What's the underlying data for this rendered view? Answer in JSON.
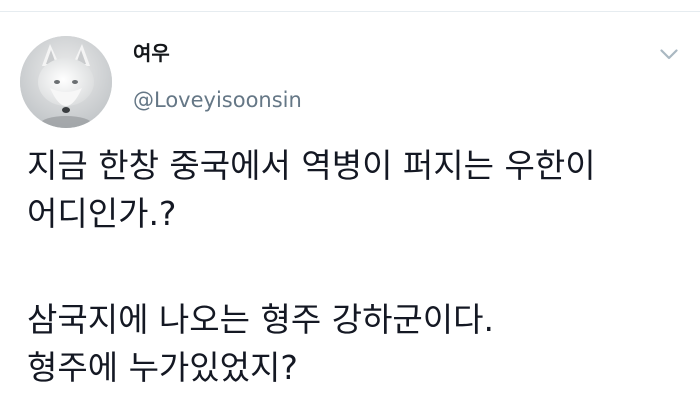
{
  "tweet": {
    "author": {
      "display_name": "여우",
      "handle": "@Loveyisoonsin",
      "avatar_icon": "fox-avatar-icon"
    },
    "menu_icon": "chevron-down-icon",
    "text_lines": [
      "지금 한창 중국에서 역병이 퍼지는 우한이",
      "어디인가.?",
      "삼국지에 나오는 형주 강하군이다.",
      "형주에 누가있었지?"
    ]
  },
  "colors": {
    "name": "#14171a",
    "handle": "#657786",
    "text": "#141823",
    "chevron": "#aab8c2",
    "divider": "#e6ecf0"
  }
}
